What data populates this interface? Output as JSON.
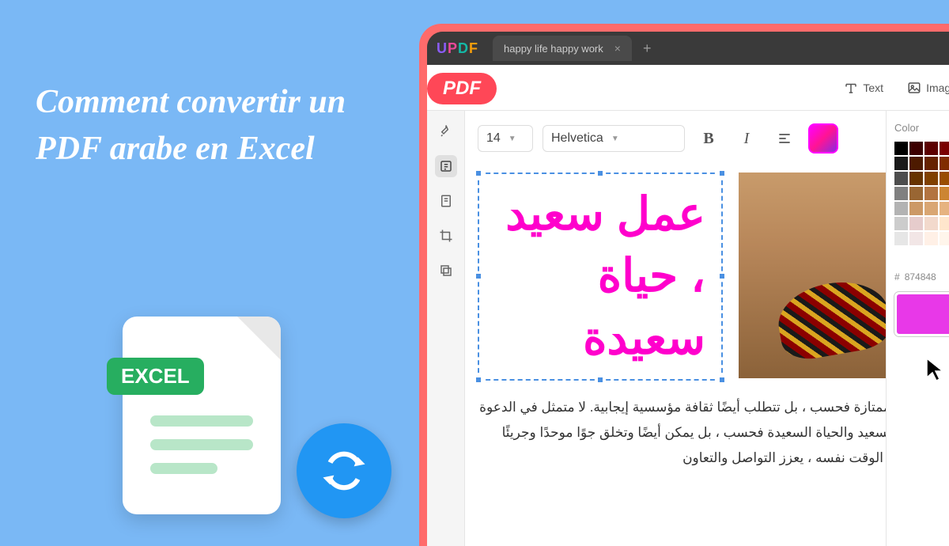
{
  "heading": "Comment convertir un PDF arabe en Excel",
  "excel_label": "EXCEL",
  "pdf_label": "PDF",
  "logo": {
    "u": "U",
    "p": "P",
    "d": "D",
    "f": "F"
  },
  "tab": {
    "title": "happy life happy work"
  },
  "toolbar": {
    "text_label": "Text",
    "image_label": "Image"
  },
  "format": {
    "font_size": "14",
    "font_family": "Helvetica",
    "bold": "B",
    "italic": "I"
  },
  "arabic_heading": "عمل سعيد ، حياة سعيدة",
  "body_text": "إدارة فريق ممتازة فحسب ، بل تتطلب أيضًا ثقافة مؤسسية إيجابية. لا متمثل في الدعوة إلى العمل السعيد والحياة السعيدة فحسب ، بل يمكن أيضًا وتخلق جوًا موحدًا وجريئًا للشركة. في الوقت نفسه ، يعزز التواصل والتعاون",
  "color_panel": {
    "title": "Color",
    "hex_prefix": "#",
    "hex_value": "874848"
  },
  "swatch_colors": [
    "#000000",
    "#3d0000",
    "#5c0000",
    "#7a0000",
    "#990000",
    "#1a1a1a",
    "#4d1a00",
    "#662200",
    "#802b00",
    "#993300",
    "#4d4d4d",
    "#663300",
    "#804000",
    "#994d00",
    "#b35900",
    "#808080",
    "#996633",
    "#b37440",
    "#cc8533",
    "#e69500",
    "#b3b3b3",
    "#cc9966",
    "#d9a673",
    "#e6b380",
    "#f2bf8c",
    "#cccccc",
    "#e6cccc",
    "#f2d9cc",
    "#ffe6cc",
    "#fff2e6",
    "#e6e6e6",
    "#f2e6e6",
    "#fff0e6",
    "#fff5eb",
    "#fffaf0",
    "#ffffff",
    "#ffffff",
    "#ffffff",
    "#ffffff",
    "#ffffff"
  ]
}
